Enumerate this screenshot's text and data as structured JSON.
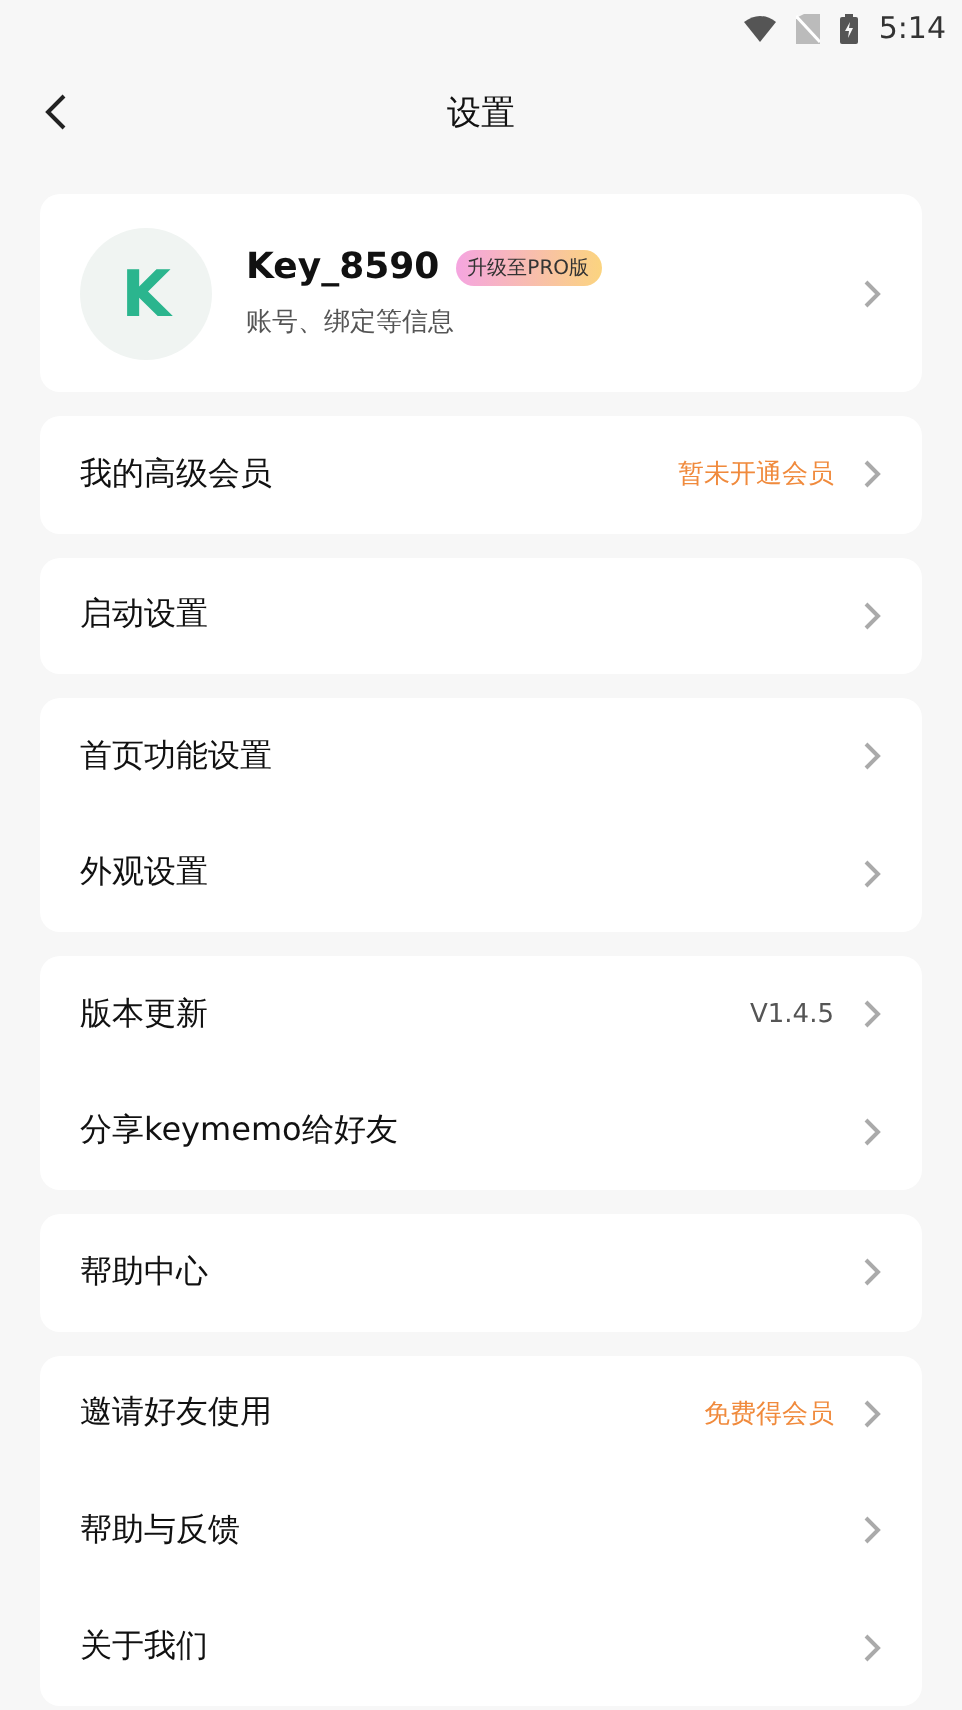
{
  "status_bar": {
    "time": "5:14"
  },
  "header": {
    "title": "设置"
  },
  "profile": {
    "avatar_letter": "K",
    "name": "Key_8590",
    "badge": "升级至PRO版",
    "subtitle": "账号、绑定等信息"
  },
  "groups": [
    {
      "items": [
        {
          "label": "我的高级会员",
          "value": "暂未开通会员",
          "highlight": true
        }
      ]
    },
    {
      "items": [
        {
          "label": "启动设置"
        }
      ]
    },
    {
      "items": [
        {
          "label": "首页功能设置"
        },
        {
          "label": "外观设置"
        }
      ]
    },
    {
      "items": [
        {
          "label": "版本更新",
          "value": "V1.4.5",
          "highlight": false
        },
        {
          "label": "分享keymemo给好友"
        }
      ]
    },
    {
      "items": [
        {
          "label": "帮助中心"
        }
      ]
    },
    {
      "items": [
        {
          "label": "邀请好友使用",
          "value": "免费得会员",
          "highlight": true
        },
        {
          "label": "帮助与反馈"
        },
        {
          "label": "关于我们"
        }
      ]
    }
  ]
}
